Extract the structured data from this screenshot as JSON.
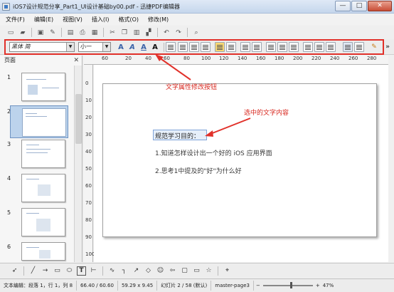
{
  "window": {
    "title": "iOS7设计规范分享_Part1_UI设计基础by00.pdf - 迅捷PDF编辑器",
    "minimize": "—",
    "maximize": "□",
    "close": "✕"
  },
  "menu": [
    "文件(F)",
    "编辑(E)",
    "视图(V)",
    "插入(I)",
    "格式(O)",
    "修改(M)"
  ],
  "format_toolbar": {
    "font_name": "黑体 简",
    "font_size": "小一",
    "bold": "A",
    "italic": "A",
    "underline": "A",
    "shadow": "A",
    "more": "»"
  },
  "side_panel": {
    "title": "页面",
    "close": "✕",
    "page_numbers": [
      "1",
      "2",
      "3",
      "4",
      "5",
      "6"
    ]
  },
  "ruler": {
    "top_labels": [
      "60",
      "20",
      "40",
      "60",
      "80",
      "100",
      "120",
      "140",
      "160",
      "180",
      "200",
      "220",
      "240",
      "260",
      "280"
    ],
    "left_labels": [
      "0",
      "10",
      "20",
      "30",
      "40",
      "50",
      "60",
      "70",
      "80",
      "90",
      "100"
    ]
  },
  "document": {
    "heading": "规范学习目的：",
    "line1": "1.知道怎样设计出一个好的 iOS 应用界面",
    "line2": "2.思考1中提及的\"好\"为什么好"
  },
  "annotations": {
    "toolbar_note": "文字属性修改按钮",
    "selection_note": "选中的文字内容",
    "accent_color": "#e1312a"
  },
  "status": {
    "mode": "文本编辑：段落 1，行 1，列 8",
    "position": "66.40 / 60.60",
    "size": "59.29 x 9.45",
    "slide": "幻灯片 2 / 58 (默认)",
    "master": "master-page3",
    "zoom": "47%"
  }
}
